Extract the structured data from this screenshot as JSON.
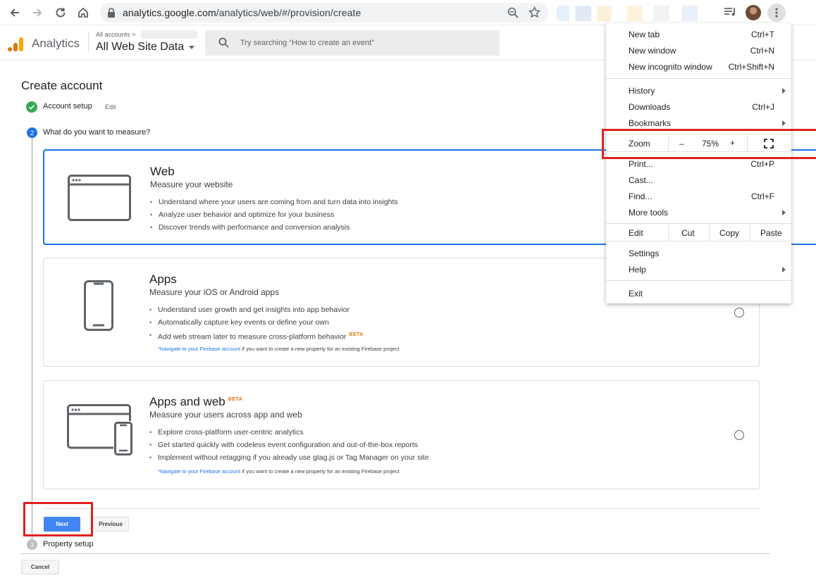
{
  "browser": {
    "url_host": "analytics.google.com",
    "url_path": "/analytics/web/#/provision/create"
  },
  "ga_header": {
    "app_name": "Analytics",
    "breadcrumb": "All accounts >",
    "view_name": "All Web Site Data",
    "search_placeholder": "Try searching “How to create an event”"
  },
  "page": {
    "title": "Create account",
    "steps": [
      {
        "number": "",
        "label": "Account setup",
        "edit": "Edit"
      },
      {
        "number": "2",
        "label": "What do you want to measure?"
      },
      {
        "number": "3",
        "label": "Property setup"
      }
    ],
    "options": [
      {
        "title": "Web",
        "subtitle": "Measure your website",
        "bullets": [
          "Understand where your users are coming from and turn data into insights",
          "Analyze user behavior and optimize for your business",
          "Discover trends with performance and conversion analysis"
        ],
        "selected": true
      },
      {
        "title": "Apps",
        "subtitle": "Measure your iOS or Android apps",
        "bullets": [
          "Understand user growth and get insights into app behavior",
          "Automatically capture key events or define your own",
          "Add web stream later to measure cross-platform behavior"
        ],
        "beta": "BETA",
        "note_link": "*Navigate to your Firebase account",
        "note_text": " if you want to create a new property for an existing Firebase project",
        "selected": false
      },
      {
        "title": "Apps and web",
        "beta": "BETA",
        "subtitle": "Measure your users across app and web",
        "bullets": [
          "Explore cross-platform user-centric analytics",
          "Get started quickly with codeless event configuration and out-of-the-box reports",
          "Implement without retagging if you already use gtag.js or Tag Manager on your site"
        ],
        "note_link": "*Navigate to your Firebase account",
        "note_text": " if you want to create a new property for an existing Firebase project",
        "selected": false
      }
    ],
    "buttons": {
      "next": "Next",
      "previous": "Previous",
      "cancel": "Cancel"
    }
  },
  "chrome_menu": {
    "new_tab": {
      "label": "New tab",
      "shortcut": "Ctrl+T"
    },
    "new_window": {
      "label": "New window",
      "shortcut": "Ctrl+N"
    },
    "new_incognito": {
      "label": "New incognito window",
      "shortcut": "Ctrl+Shift+N"
    },
    "history": "History",
    "downloads": {
      "label": "Downloads",
      "shortcut": "Ctrl+J"
    },
    "bookmarks": "Bookmarks",
    "zoom": {
      "label": "Zoom",
      "minus": "–",
      "value": "75%",
      "plus": "+"
    },
    "print": {
      "label": "Print...",
      "shortcut": "Ctrl+P"
    },
    "cast": "Cast...",
    "find": {
      "label": "Find...",
      "shortcut": "Ctrl+F"
    },
    "more_tools": "More tools",
    "edit": {
      "label": "Edit",
      "cut": "Cut",
      "copy": "Copy",
      "paste": "Paste"
    },
    "settings": "Settings",
    "help": "Help",
    "exit": "Exit"
  },
  "colors": {
    "primary_blue": "#1a73e8",
    "next_button": "#4285f4",
    "success_green": "#34a853",
    "highlight_red": "#e02020",
    "beta_orange": "#e37400"
  }
}
